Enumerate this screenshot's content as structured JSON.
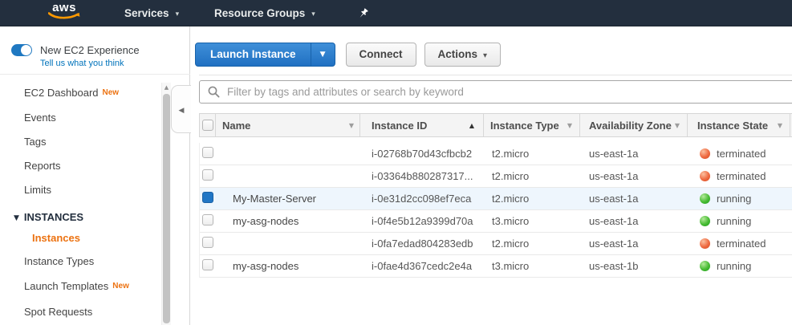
{
  "topnav": {
    "logo_text": "aws",
    "services_label": "Services",
    "resource_groups_label": "Resource Groups"
  },
  "sidebar": {
    "toggle_label": "New EC2 Experience",
    "feedback_link": "Tell us what you think",
    "items": [
      {
        "label": "EC2 Dashboard",
        "badge": "New"
      },
      {
        "label": "Events"
      },
      {
        "label": "Tags"
      },
      {
        "label": "Reports"
      },
      {
        "label": "Limits"
      }
    ],
    "section_label": "INSTANCES",
    "section_items": [
      {
        "label": "Instances",
        "selected": true
      },
      {
        "label": "Instance Types"
      },
      {
        "label": "Launch Templates",
        "badge": "New"
      },
      {
        "label": "Spot Requests"
      }
    ]
  },
  "toolbar": {
    "launch_label": "Launch Instance",
    "connect_label": "Connect",
    "actions_label": "Actions"
  },
  "filter": {
    "placeholder": "Filter by tags and attributes or search by keyword"
  },
  "table": {
    "columns": [
      {
        "label": "Name",
        "sorted": false
      },
      {
        "label": "Instance ID",
        "sorted": true,
        "direction": "asc"
      },
      {
        "label": "Instance Type",
        "sorted": false
      },
      {
        "label": "Availability Zone",
        "sorted": false
      },
      {
        "label": "Instance State",
        "sorted": false
      }
    ],
    "rows": [
      {
        "name": "",
        "instance_id": "i-02768b70d43cfbcb2",
        "type": "t2.micro",
        "az": "us-east-1a",
        "state": "terminated",
        "state_color": "red",
        "selected": false
      },
      {
        "name": "",
        "instance_id": "i-03364b880287317...",
        "type": "t2.micro",
        "az": "us-east-1a",
        "state": "terminated",
        "state_color": "red",
        "selected": false
      },
      {
        "name": "My-Master-Server",
        "instance_id": "i-0e31d2cc098ef7eca",
        "type": "t2.micro",
        "az": "us-east-1a",
        "state": "running",
        "state_color": "green",
        "selected": true
      },
      {
        "name": "my-asg-nodes",
        "instance_id": "i-0f4e5b12a9399d70a",
        "type": "t3.micro",
        "az": "us-east-1a",
        "state": "running",
        "state_color": "green",
        "selected": false
      },
      {
        "name": "",
        "instance_id": "i-0fa7edad804283edb",
        "type": "t2.micro",
        "az": "us-east-1a",
        "state": "terminated",
        "state_color": "red",
        "selected": false
      },
      {
        "name": "my-asg-nodes",
        "instance_id": "i-0fae4d367cedc2e4a",
        "type": "t3.micro",
        "az": "us-east-1b",
        "state": "running",
        "state_color": "green",
        "selected": false
      }
    ]
  },
  "icons": {
    "caret_down": "▾",
    "sort_asc": "▲",
    "sort_desc": "▼",
    "section_caret": "▼",
    "collapse_left": "◀",
    "scroll_up": "▲"
  },
  "colors": {
    "nav_bg": "#232f3e",
    "aws_orange": "#ff9900",
    "accent_orange": "#ec7211",
    "link_blue": "#0073bb",
    "primary_button_blue": "#2070c2",
    "selected_row_bg": "#eef6fd",
    "status_running_green": "#3fbb39",
    "status_terminated_red": "#ee6a41"
  }
}
